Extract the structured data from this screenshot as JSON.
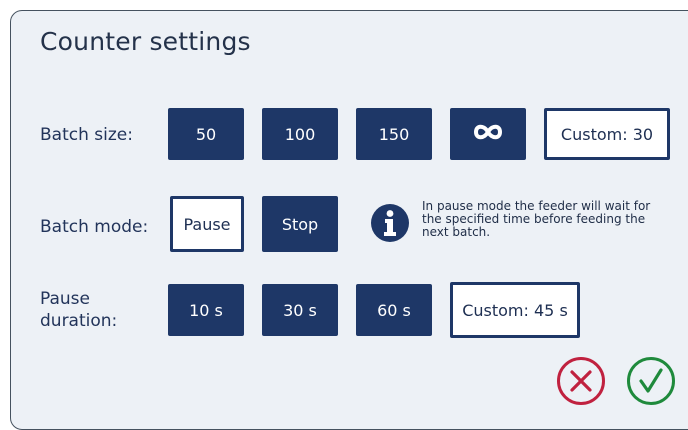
{
  "title": "Counter settings",
  "batch_size": {
    "label": "Batch size:",
    "options": [
      "50",
      "100",
      "150"
    ],
    "infinite_icon": "infinity-icon",
    "custom_label": "Custom: 30"
  },
  "batch_mode": {
    "label": "Batch mode:",
    "pause_label": "Pause",
    "stop_label": "Stop",
    "info_icon": "info-icon",
    "info_text": "In pause mode the feeder will wait for the specified time before feeding the next batch."
  },
  "pause_duration": {
    "label_line1": "Pause",
    "label_line2": "duration:",
    "options": [
      "10 s",
      "30 s",
      "60 s"
    ],
    "custom_label": "Custom: 45 s"
  },
  "actions": {
    "cancel_icon": "cancel-icon",
    "confirm_icon": "confirm-icon"
  },
  "colors": {
    "button_fill": "#1e3767",
    "panel_bg": "#edf1f6",
    "cancel": "#c0213f",
    "confirm": "#1f8a3c"
  }
}
